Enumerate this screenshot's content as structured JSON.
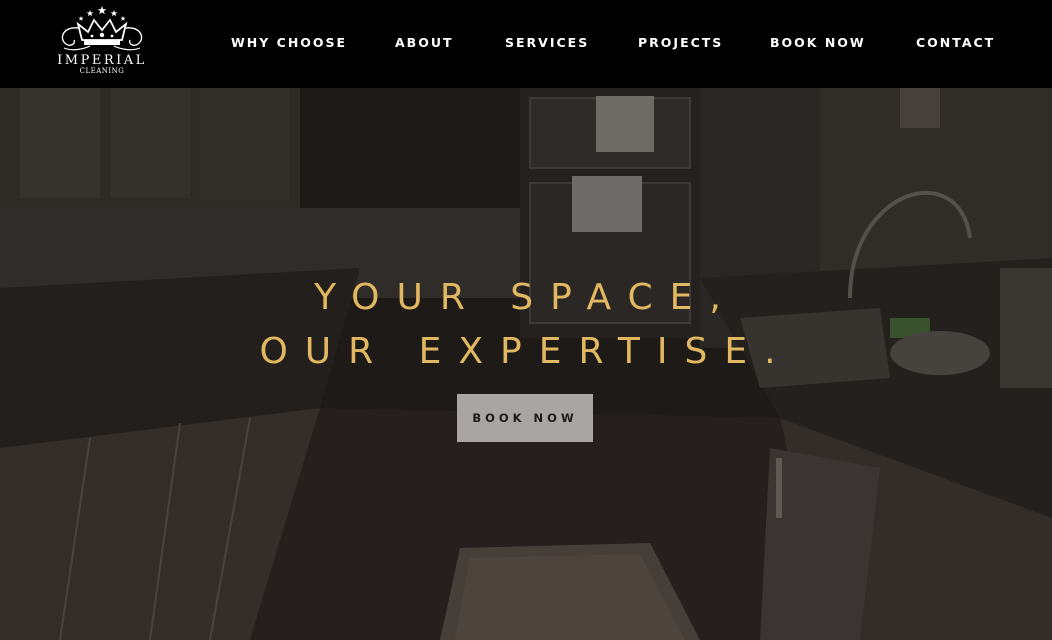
{
  "brand": {
    "name": "IMPERIAL",
    "tagline": "CLEANING"
  },
  "nav": {
    "items": [
      {
        "label": "WHY CHOOSE"
      },
      {
        "label": "ABOUT"
      },
      {
        "label": "SERVICES"
      },
      {
        "label": "PROJECTS"
      },
      {
        "label": "BOOK NOW"
      },
      {
        "label": "CONTACT"
      }
    ]
  },
  "hero": {
    "headline_line1": "YOUR SPACE,",
    "headline_line2": "OUR EXPERTISE.",
    "cta_label": "BOOK NOW"
  },
  "colors": {
    "accent": "#e1b861",
    "header_bg": "#000000",
    "button_bg": "#a8a5a2",
    "button_text": "#1d1b19"
  },
  "icons": {
    "logo": "crown-logo-icon"
  }
}
